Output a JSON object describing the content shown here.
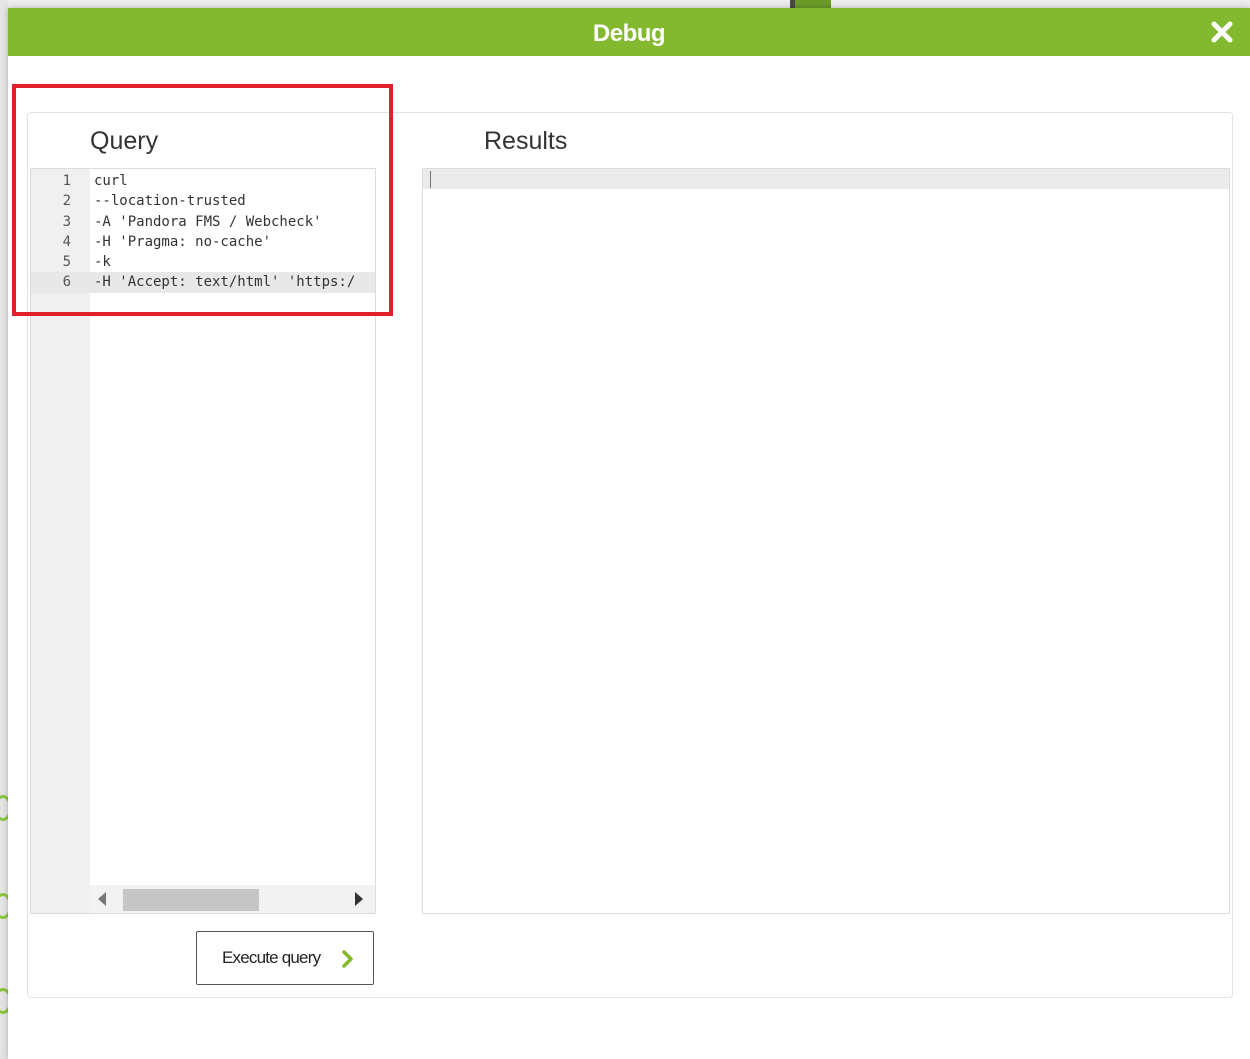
{
  "dialog": {
    "title": "Debug",
    "close_icon": "close-icon"
  },
  "query": {
    "title": "Query",
    "lines": [
      {
        "num": "1",
        "text": "curl"
      },
      {
        "num": "2",
        "text": "--location-trusted"
      },
      {
        "num": "3",
        "text": "-A 'Pandora FMS / Webcheck'"
      },
      {
        "num": "4",
        "text": "-H 'Pragma: no-cache'"
      },
      {
        "num": "5",
        "text": "-k"
      },
      {
        "num": "6",
        "text": "-H 'Accept: text/html' 'https:/"
      }
    ],
    "active_line": 6
  },
  "results": {
    "title": "Results"
  },
  "actions": {
    "execute_label": "Execute query",
    "execute_icon": "chevron-right-icon"
  },
  "colors": {
    "titlebar": "#82b92e",
    "highlight": "#e0202a",
    "chevron": "#82b92e"
  }
}
